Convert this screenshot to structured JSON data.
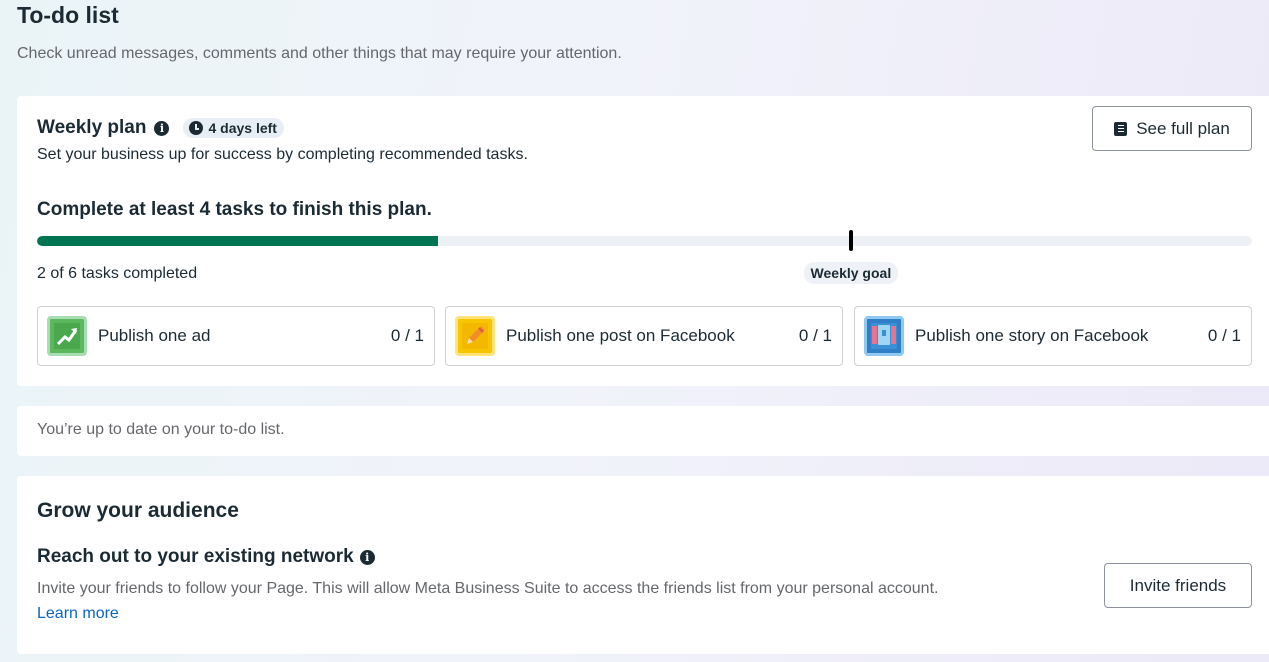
{
  "header": {
    "title": "To-do list",
    "subtitle": "Check unread messages, comments and other things that may require your attention."
  },
  "weekly_plan": {
    "title": "Weekly plan",
    "days_left": "4 days left",
    "description": "Set your business up for success by completing recommended tasks.",
    "see_full_plan_label": "See full plan",
    "goal_heading": "Complete at least 4 tasks to finish this plan.",
    "progress_fraction": 0.33,
    "goal_fraction": 0.67,
    "tasks_completed": "2 of 6 tasks completed",
    "weekly_goal_label": "Weekly goal",
    "tasks": [
      {
        "label": "Publish one ad",
        "count": "0 / 1",
        "icon": "ad-chart-icon"
      },
      {
        "label": "Publish one post on Facebook",
        "count": "0 / 1",
        "icon": "post-pencil-icon"
      },
      {
        "label": "Publish one story on Facebook",
        "count": "0 / 1",
        "icon": "story-icon"
      }
    ]
  },
  "status": {
    "up_to_date": "You’re up to date on your to-do list."
  },
  "grow": {
    "title": "Grow your audience",
    "reach_title": "Reach out to your existing network",
    "reach_desc": "Invite your friends to follow your Page. This will allow Meta Business Suite to access the friends list from your personal account.",
    "learn_more": "Learn more",
    "invite_label": "Invite friends"
  },
  "colors": {
    "progress": "#007552",
    "link": "#0a66c2"
  }
}
